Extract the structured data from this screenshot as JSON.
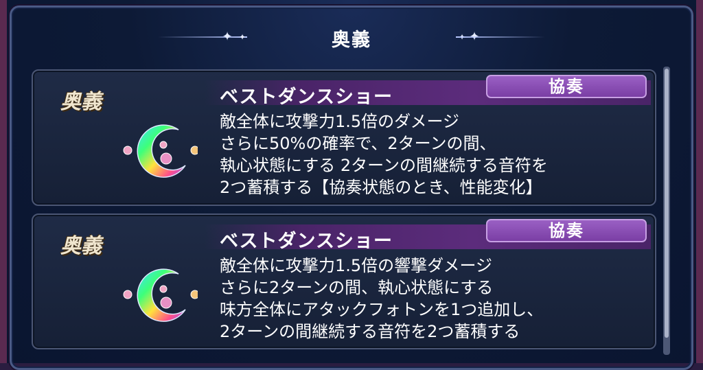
{
  "header": {
    "title": "奥義"
  },
  "skills": [
    {
      "category": "奥義",
      "name": "ベストダンスショー",
      "tag": "協奏",
      "lines": [
        "敵全体に攻撃力1.5倍のダメージ",
        "さらに50%の確率で、2ターンの間、",
        "執心状態にする 2ターンの間継続する音符を",
        "2つ蓄積する【協奏状態のとき、性能変化】"
      ]
    },
    {
      "category": "奥義",
      "name": "ベストダンスショー",
      "tag": "協奏",
      "lines": [
        "敵全体に攻撃力1.5倍の響撃ダメージ",
        "さらに2ターンの間、執心状態にする",
        "味方全体にアタックフォトンを1つ追加し、",
        "2ターンの間継続する音符を2つ蓄積する"
      ]
    }
  ],
  "colors": {
    "accent": "#7a3ea4",
    "panel": "#1f2b46",
    "text": "#ffffff"
  }
}
